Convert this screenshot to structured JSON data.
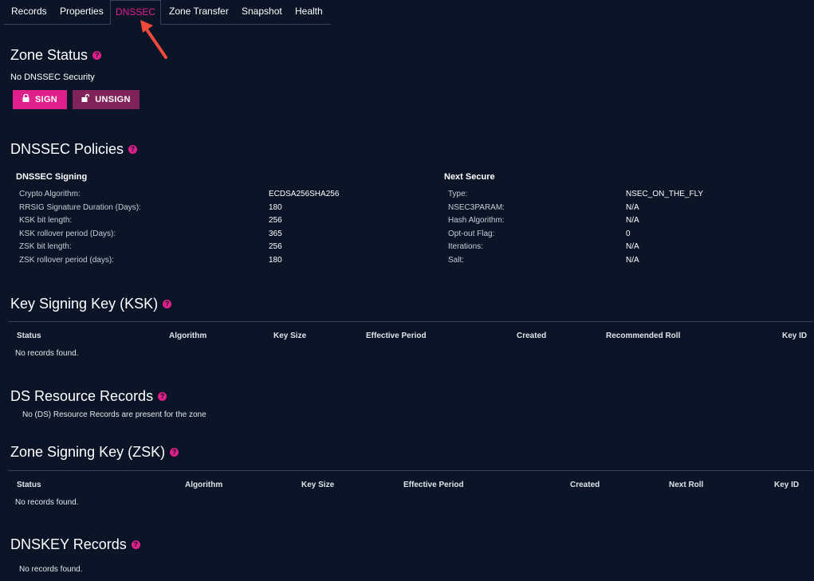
{
  "tabs": [
    "Records",
    "Properties",
    "DNSSEC",
    "Zone Transfer",
    "Snapshot",
    "Health"
  ],
  "help_glyph": "?",
  "zone_status": {
    "title": "Zone Status",
    "status_text": "No DNSSEC Security",
    "sign_label": "SIGN",
    "unsign_label": "UNSIGN"
  },
  "policies": {
    "title": "DNSSEC Policies",
    "signing": {
      "heading": "DNSSEC Signing",
      "rows": [
        {
          "label": "Crypto Algorithm:",
          "value": "ECDSA256SHA256"
        },
        {
          "label": "RRSIG Signature Duration (Days):",
          "value": "180"
        },
        {
          "label": "KSK bit length:",
          "value": "256"
        },
        {
          "label": "KSK rollover period (Days):",
          "value": "365"
        },
        {
          "label": "ZSK bit length:",
          "value": "256"
        },
        {
          "label": "ZSK rollover period (days):",
          "value": "180"
        }
      ]
    },
    "next_secure": {
      "heading": "Next Secure",
      "rows": [
        {
          "label": "Type:",
          "value": "NSEC_ON_THE_FLY"
        },
        {
          "label": "NSEC3PARAM:",
          "value": "N/A"
        },
        {
          "label": "Hash Algorithm:",
          "value": "N/A"
        },
        {
          "label": "Opt-out Flag:",
          "value": "0"
        },
        {
          "label": "Iterations:",
          "value": "N/A"
        },
        {
          "label": "Salt:",
          "value": "N/A"
        }
      ]
    }
  },
  "ksk": {
    "title": "Key Signing Key (KSK)",
    "columns": [
      "Status",
      "Algorithm",
      "Key Size",
      "Effective Period",
      "Created",
      "Recommended Roll",
      "Key ID"
    ],
    "empty_text": "No records found."
  },
  "ds": {
    "title": "DS Resource Records",
    "empty_text": "No (DS) Resource Records are present for the zone"
  },
  "zsk": {
    "title": "Zone Signing Key (ZSK)",
    "columns": [
      "Status",
      "Algorithm",
      "Key Size",
      "Effective Period",
      "Created",
      "Next Roll",
      "Key ID"
    ],
    "empty_text": "No records found."
  },
  "dnskey": {
    "title": "DNSKEY Records",
    "empty_text": "No records found."
  },
  "colors": {
    "accent": "#e0208a",
    "unsign": "#7f2358",
    "background": "#0b1527",
    "arrow": "#f04a3c"
  }
}
